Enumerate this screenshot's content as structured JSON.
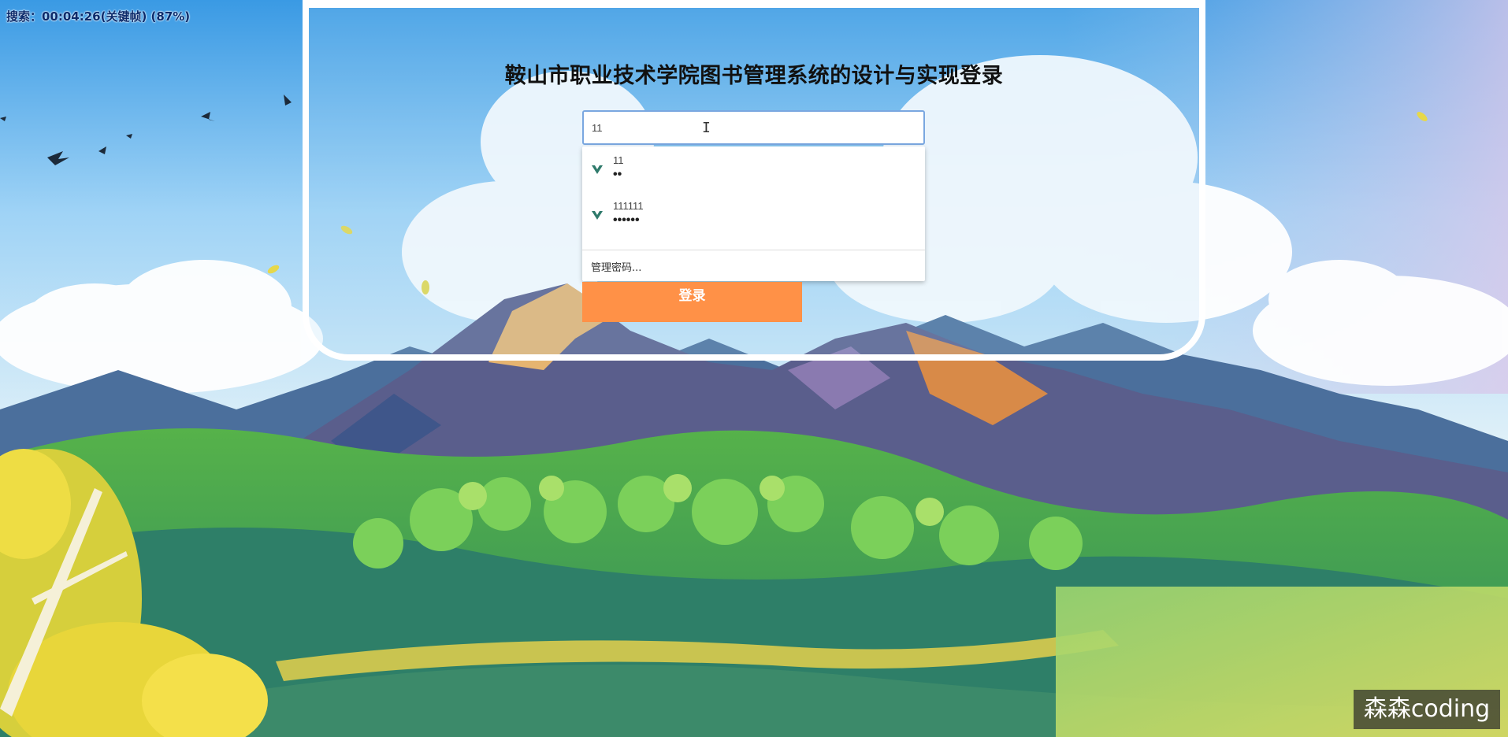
{
  "recording": {
    "status_text": "搜索：00:04:26(关键帧) (87%)"
  },
  "login": {
    "title": "鞍山市职业技术学院图书管理系统的设计与实现登录",
    "username_value": "11",
    "login_button": "登录"
  },
  "autocomplete": {
    "items": [
      {
        "username": "11",
        "password_mask": "••"
      },
      {
        "username": "111111",
        "password_mask": "••••••"
      }
    ],
    "manage_label": "管理密码..."
  },
  "watermark": {
    "text": "森森coding"
  },
  "colors": {
    "button": "#ff9147",
    "input_border": "#7aa7e0",
    "card_border": "#ffffff"
  },
  "icons": {
    "autocomplete_item": "key-icon",
    "cursor": "text-cursor-icon"
  }
}
